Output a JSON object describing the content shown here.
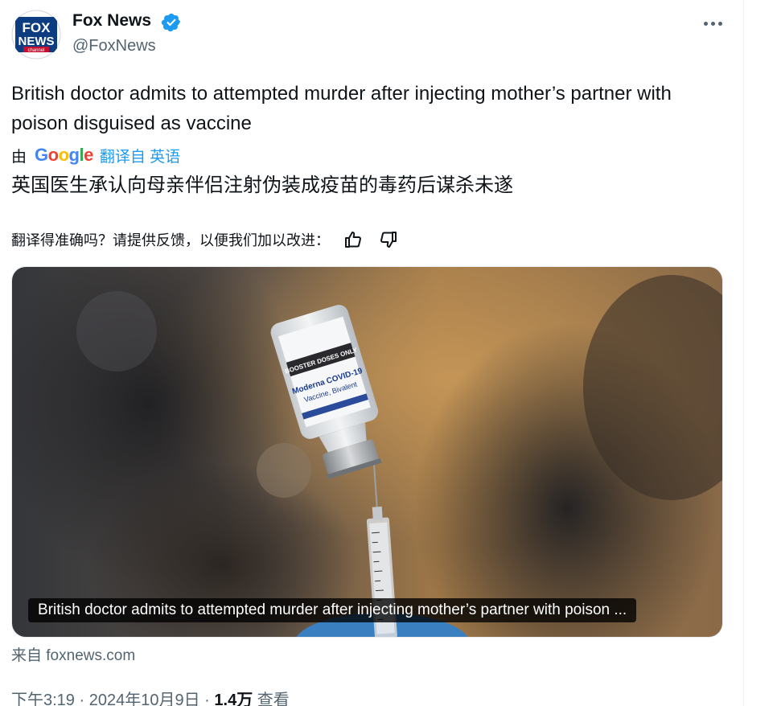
{
  "author": {
    "name": "Fox News",
    "handle": "@FoxNews",
    "verified": true,
    "avatar_logo": {
      "line1": "FOX",
      "line2": "NEWS",
      "line3": "channel"
    }
  },
  "tweet": {
    "text": "British doctor admits to attempted murder after injecting mother’s partner with poison disguised as vaccine"
  },
  "translation": {
    "prefix": "由",
    "provider": "Google",
    "link_label": "翻译自 英语",
    "translated_text": "英国医生承认向母亲伴侣注射伪装成疫苗的毒药后谋杀未遂",
    "feedback_prompt": "翻译得准确吗？请提供反馈，以便我们加以改进："
  },
  "card": {
    "caption": "British doctor admits to attempted murder after injecting mother’s partner with poison ...",
    "source_label": "来自 foxnews.com",
    "vial_label": {
      "line1": "Moderna COVID-19",
      "line2": "Vaccine, Bivalent",
      "line3": "BOOSTER DOSES ONLY"
    }
  },
  "meta": {
    "time": "下午3:19",
    "separator": "·",
    "date": "2024年10月9日",
    "views_count": "1.4万",
    "views_label": "查看"
  },
  "icons": [
    "verified-badge-icon",
    "more-icon",
    "thumbs-up-icon",
    "thumbs-down-icon"
  ],
  "colors": {
    "link": "#1d9bf0",
    "secondary_text": "#536471",
    "verified": "#1d9bf0"
  }
}
